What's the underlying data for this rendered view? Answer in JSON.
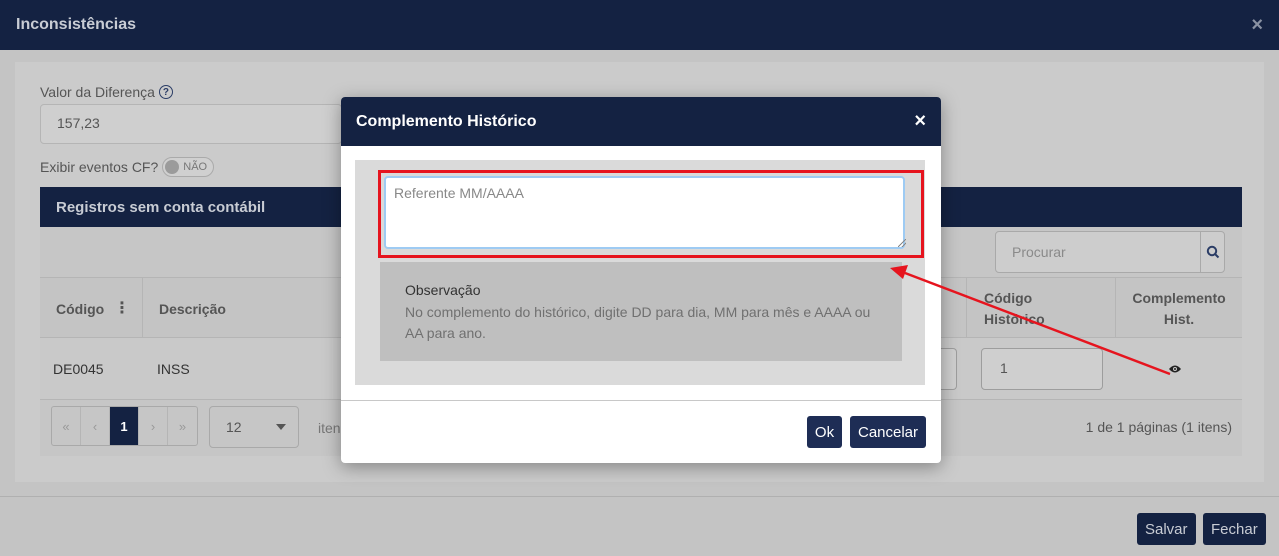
{
  "page": {
    "title": "Inconsistências",
    "close": "×",
    "value_label": "Valor da Diferença",
    "help": "?",
    "value": "157,23",
    "cf_label": "Exibir eventos CF?",
    "cf_toggle": "NÃO",
    "grid_title": "Registros sem conta contábil",
    "search_placeholder": "Procurar",
    "columns": {
      "codigo": "Código",
      "descricao": "Descrição",
      "codigo_historico_1": "Código",
      "codigo_historico_2": "Histórico",
      "complemento_1": "Complemento",
      "complemento_2": "Hist."
    },
    "row": {
      "codigo": "DE0045",
      "descricao": "INSS",
      "codigo_historico": "1"
    },
    "pager": {
      "first": "«",
      "prev": "‹",
      "current": "1",
      "next": "›",
      "last": "»",
      "page_size": "12",
      "items_label": "iten",
      "info": "1 de 1 páginas (1 itens)"
    },
    "footer": {
      "save": "Salvar",
      "close": "Fechar"
    }
  },
  "modal": {
    "title": "Complemento Histórico",
    "close": "×",
    "textarea_value": "Referente MM/AAAA",
    "obs_title": "Observação",
    "obs_text": "No complemento do histórico, digite DD para dia, MM para mês e AAAA ou AA para ano.",
    "ok": "Ok",
    "cancel": "Cancelar"
  },
  "colors": {
    "header_bg": "#142242",
    "highlight": "#e6141e",
    "arrow": "#e6141e"
  }
}
